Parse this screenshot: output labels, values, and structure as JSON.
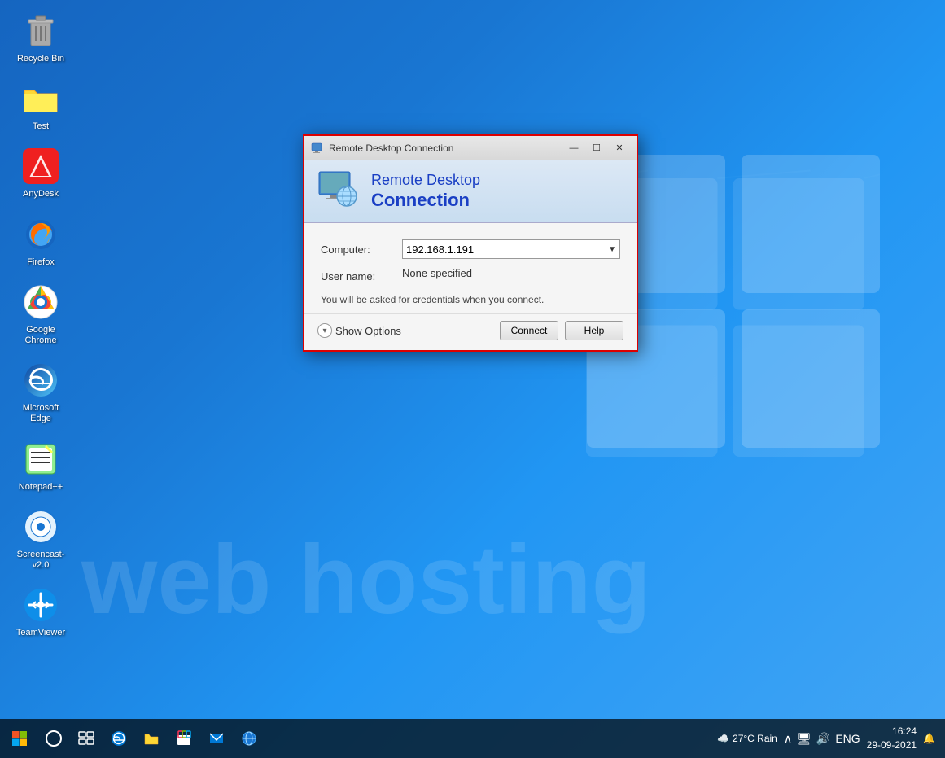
{
  "desktop": {
    "background": "Windows 10 blue gradient",
    "watermark_text": "web hosting"
  },
  "icons": [
    {
      "id": "recycle-bin",
      "label": "Recycle Bin",
      "emoji": "🗑️"
    },
    {
      "id": "test-folder",
      "label": "Test",
      "emoji": "📁"
    },
    {
      "id": "anydesk",
      "label": "AnyDesk",
      "emoji": "🔴"
    },
    {
      "id": "firefox",
      "label": "Firefox",
      "emoji": "🦊"
    },
    {
      "id": "google-chrome",
      "label": "Google Chrome",
      "emoji": "🌐"
    },
    {
      "id": "microsoft-edge",
      "label": "Microsoft Edge",
      "emoji": "🌀"
    },
    {
      "id": "notepadpp",
      "label": "Notepad++",
      "emoji": "📝"
    },
    {
      "id": "screencast",
      "label": "Screencast-v2.0",
      "emoji": "🎬"
    },
    {
      "id": "teamviewer",
      "label": "TeamViewer",
      "emoji": "↔️"
    }
  ],
  "dialog": {
    "title": "Remote Desktop Connection",
    "header_line1": "Remote Desktop",
    "header_line2": "Connection",
    "computer_label": "Computer:",
    "computer_value": "192.168.1.191",
    "username_label": "User name:",
    "username_value": "None specified",
    "info_text": "You will be asked for credentials when you connect.",
    "show_options_label": "Show Options",
    "connect_button": "Connect",
    "help_button": "Help",
    "titlebar_controls": {
      "minimize": "—",
      "restore": "☐",
      "close": "✕"
    }
  },
  "taskbar": {
    "start_icon": "⊞",
    "search_icon": "○",
    "task_view_icon": "⊡",
    "edge_icon": "edge",
    "file_explorer_icon": "📁",
    "store_icon": "🏪",
    "mail_icon": "✉",
    "remote_icon": "🖥",
    "weather": "27°C Rain",
    "language": "ENG",
    "time": "16:24",
    "date": "29-09-2021",
    "notification_icon": "🔔"
  }
}
